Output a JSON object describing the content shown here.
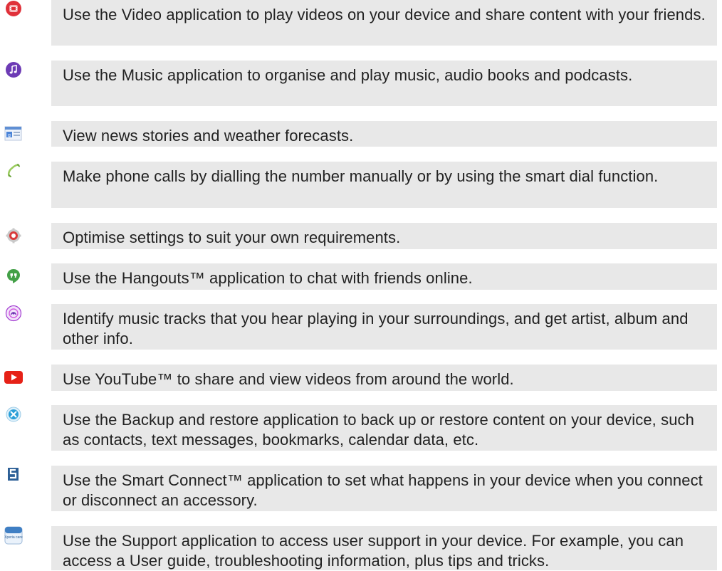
{
  "items": [
    {
      "icon": "video-icon",
      "text": "Use the Video application to play videos on your device and share content with your friends."
    },
    {
      "icon": "music-icon",
      "text": "Use the Music application to organise and play music, audio books and podcasts."
    },
    {
      "icon": "news-weather-icon",
      "text": "View news stories and weather forecasts."
    },
    {
      "icon": "phone-icon",
      "text": "Make phone calls by dialling the number manually or by using the smart dial function."
    },
    {
      "icon": "settings-icon",
      "text": "Optimise settings to suit your own requirements."
    },
    {
      "icon": "hangouts-icon",
      "text": "Use the Hangouts™ application to chat with friends online."
    },
    {
      "icon": "trackid-icon",
      "text": "Identify music tracks that you hear playing in your surroundings, and get artist, album and other info."
    },
    {
      "icon": "youtube-icon",
      "text": "Use YouTube™ to share and view videos from around the world."
    },
    {
      "icon": "backup-restore-icon",
      "text": "Use the Backup and restore application to back up or restore content on your device, such as contacts, text messages, bookmarks, calendar data, etc."
    },
    {
      "icon": "smart-connect-icon",
      "text": "Use the Smart Connect™ application to set what happens in your device when you connect or disconnect an accessory."
    },
    {
      "icon": "xperia-care-icon",
      "text": "Use the Support application to access user support in your device. For example, you can access a User guide, troubleshooting information, plus tips and tricks.",
      "icon_label": "Xperia care"
    }
  ],
  "colors": {
    "row_background": "#e8e8e8",
    "video": "#e0313a",
    "music": "#6d3bb5",
    "hangouts": "#43a047",
    "youtube": "#e62117",
    "settings": "#d93a3a",
    "trackid": "#a23bd0",
    "backup": "#2a9fd8"
  }
}
